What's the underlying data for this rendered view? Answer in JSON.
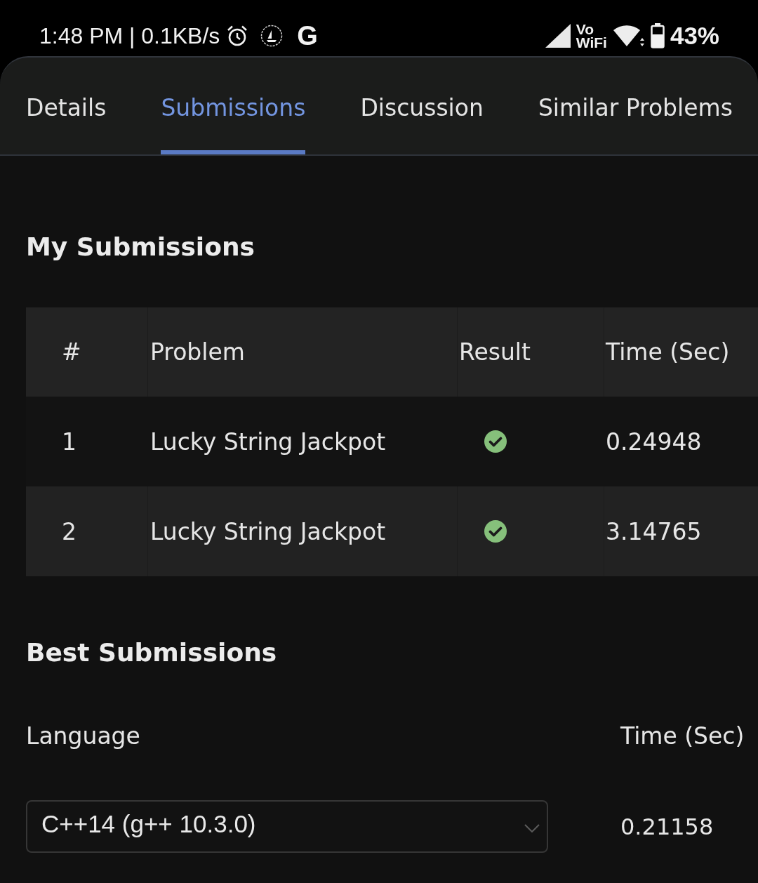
{
  "status_bar": {
    "time": "1:48 PM | 0.1KB/s",
    "notification_letter": "G",
    "network_label": "Vo WiFi",
    "battery": "43%"
  },
  "tabs": [
    {
      "label": "Details",
      "selected": false
    },
    {
      "label": "Submissions",
      "selected": true
    },
    {
      "label": "Discussion",
      "selected": false
    },
    {
      "label": "Similar Problems",
      "selected": false
    }
  ],
  "my_submissions": {
    "title": "My Submissions",
    "table": {
      "columns": [
        "#",
        "Problem",
        "Result",
        "Time (Sec)"
      ],
      "rows": [
        {
          "number": "1",
          "problem": "Lucky String Jackpot",
          "accepted": true,
          "time": "0.24948"
        },
        {
          "number": "2",
          "problem": "Lucky String Jackpot",
          "accepted": true,
          "time": "3.14765"
        }
      ]
    }
  },
  "best_submissions": {
    "title": "Best Submissions",
    "language_label": "Language",
    "time_label": "Time (Sec)",
    "language_select": {
      "value": "C++14 (g++ 10.3.0)"
    },
    "time": "0.21158"
  }
}
